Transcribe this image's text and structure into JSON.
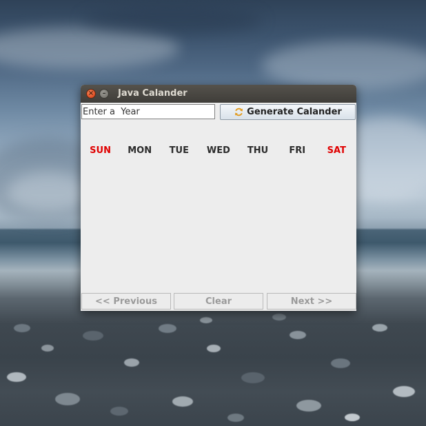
{
  "window": {
    "title": "Java Calander",
    "close_glyph": "×",
    "minimize_glyph": "–"
  },
  "input": {
    "placeholder": "Enter a  Year",
    "value": ""
  },
  "generate_button": {
    "label": "Generate Calander",
    "icon": "refresh-icon"
  },
  "weekdays": [
    {
      "label": "SUN",
      "weekend": true
    },
    {
      "label": "MON",
      "weekend": false
    },
    {
      "label": "TUE",
      "weekend": false
    },
    {
      "label": "WED",
      "weekend": false
    },
    {
      "label": "THU",
      "weekend": false
    },
    {
      "label": "FRI",
      "weekend": false
    },
    {
      "label": "SAT",
      "weekend": true
    }
  ],
  "nav": {
    "previous_label": "<< Previous",
    "clear_label": "Clear",
    "next_label": "Next >>"
  },
  "colors": {
    "weekend": "#e00000",
    "weekday": "#2b2b2b",
    "disabled_text": "#9a9a9a",
    "window_bg": "#ededed",
    "titlebar": "#4a4843"
  }
}
